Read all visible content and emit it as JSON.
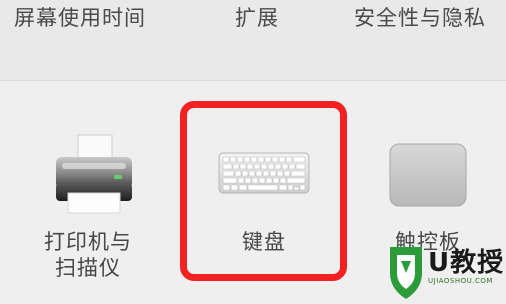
{
  "top_row": {
    "items": [
      {
        "label": "屏幕使用时间"
      },
      {
        "label": "扩展"
      },
      {
        "label": "安全性与隐私"
      }
    ]
  },
  "panes": {
    "printers": {
      "label_line1": "打印机与",
      "label_line2": "扫描仪",
      "icon": "printer-icon"
    },
    "keyboard": {
      "label": "键盘",
      "icon": "keyboard-icon"
    },
    "trackpad": {
      "label": "触控板",
      "icon": "trackpad-icon"
    }
  },
  "highlight": {
    "color": "#f22222",
    "target": "keyboard"
  },
  "watermark": {
    "text": "U教授",
    "url_text": "UJIAOSHOU.COM"
  }
}
